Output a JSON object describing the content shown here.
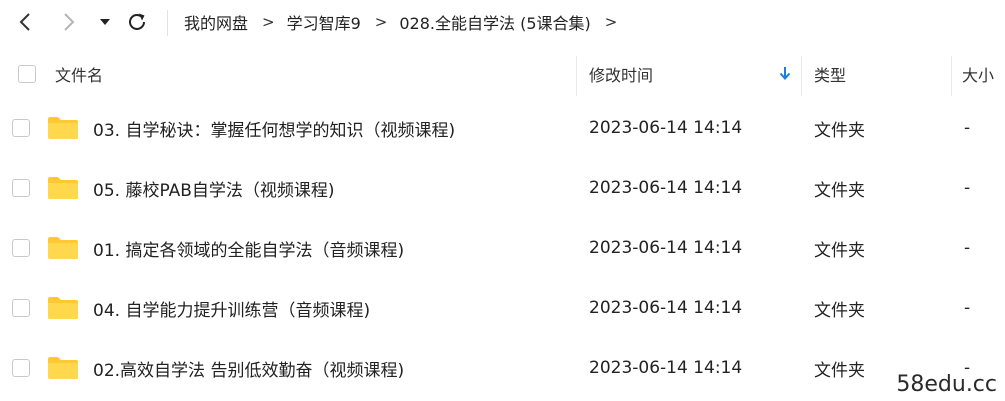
{
  "toolbar": {
    "breadcrumb": [
      "我的网盘",
      "学习智库9",
      "028.全能自学法 (5课合集)"
    ],
    "separator": ">"
  },
  "header": {
    "name": "文件名",
    "modified": "修改时间",
    "type": "类型",
    "size": "大小"
  },
  "rows": [
    {
      "name": "03. 自学秘诀：掌握任何想学的知识（视频课程)",
      "modified": "2023-06-14 14:14",
      "type": "文件夹",
      "size": "-"
    },
    {
      "name": "05. 藤校PAB自学法（视频课程)",
      "modified": "2023-06-14 14:14",
      "type": "文件夹",
      "size": "-"
    },
    {
      "name": "01. 搞定各领域的全能自学法（音频课程)",
      "modified": "2023-06-14 14:14",
      "type": "文件夹",
      "size": "-"
    },
    {
      "name": "04. 自学能力提升训练营（音频课程)",
      "modified": "2023-06-14 14:14",
      "type": "文件夹",
      "size": "-"
    },
    {
      "name": "02.高效自学法 告别低效勤奋（视频课程)",
      "modified": "2023-06-14 14:14",
      "type": "文件夹",
      "size": "-"
    }
  ],
  "watermark": "58edu.cc",
  "colors": {
    "folder": "#FFC933",
    "sort_arrow": "#1a7fe0"
  }
}
